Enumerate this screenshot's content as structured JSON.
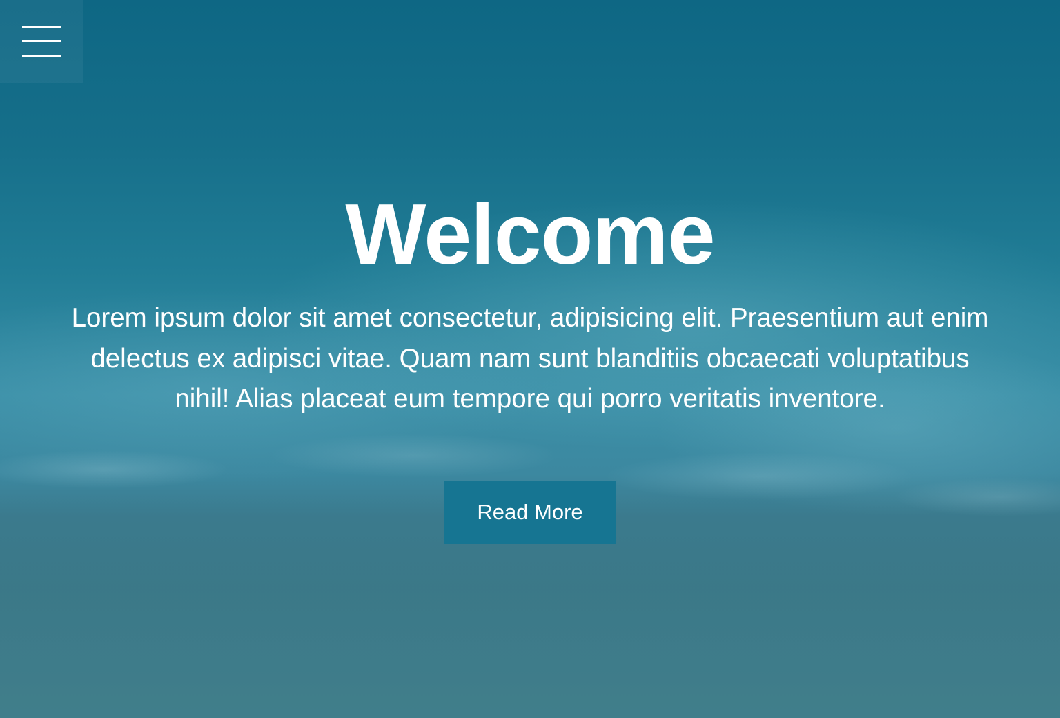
{
  "menu": {
    "icon": "hamburger-menu-icon"
  },
  "hero": {
    "title": "Welcome",
    "description": "Lorem ipsum dolor sit amet consectetur, adipisicing elit. Praesentium aut enim delectus ex adipisci vitae. Quam nam sunt blanditiis obcaecati voluptatibus nihil! Alias placeat eum tempore qui porro veritatis inventore.",
    "button_label": "Read More",
    "background_image": "ocean-aerial-background",
    "colors": {
      "button_background": "#167592",
      "text": "#ffffff",
      "ocean_deep": "#0e6784",
      "ocean_shore": "#3a8fa7"
    }
  }
}
